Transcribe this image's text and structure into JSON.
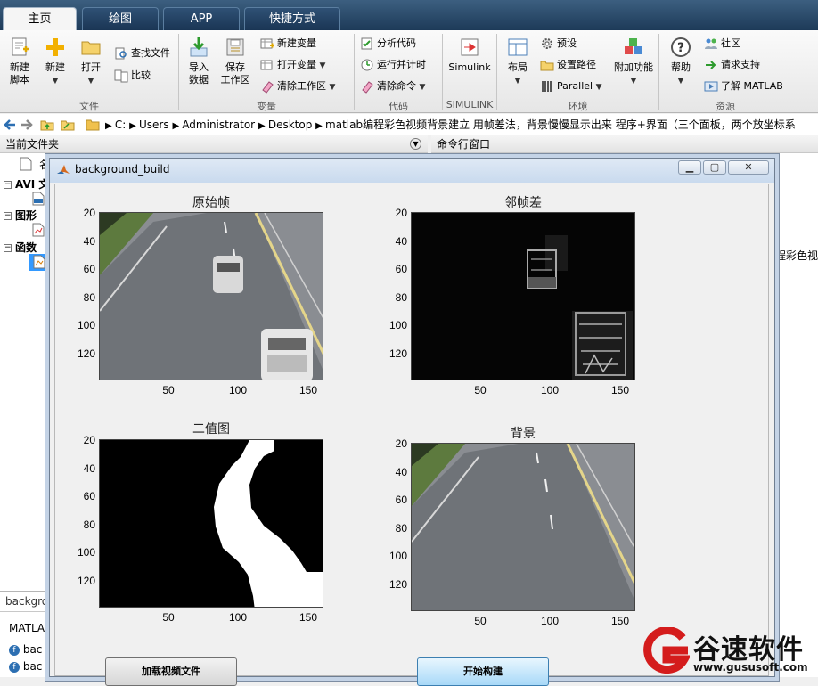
{
  "tabs": [
    {
      "label": "主页",
      "active": true
    },
    {
      "label": "绘图"
    },
    {
      "label": "APP"
    },
    {
      "label": "快捷方式"
    }
  ],
  "ribbon": {
    "file": {
      "label": "文件",
      "new_script": [
        "新建",
        "脚本"
      ],
      "new": "新建",
      "open": "打开",
      "find_files": "查找文件",
      "compare": "比较"
    },
    "variable": {
      "label": "变量",
      "import_data": [
        "导入",
        "数据"
      ],
      "save_workspace": [
        "保存",
        "工作区"
      ],
      "new_variable": "新建变量",
      "open_variable": "打开变量",
      "clear_workspace": "清除工作区"
    },
    "code": {
      "label": "代码",
      "analyze_code": "分析代码",
      "run_and_time": "运行并计时",
      "clear_commands": "清除命令"
    },
    "simulink": {
      "label": "SIMULINK",
      "simulink": "Simulink"
    },
    "environment": {
      "label": "环境",
      "layout": "布局",
      "preferences": "预设",
      "set_path": "设置路径",
      "parallel": "Parallel",
      "addons": "附加功能"
    },
    "resources": {
      "label": "资源",
      "help": "帮助",
      "community": "社区",
      "request_support": "请求支持",
      "learn_matlab": "了解 MATLAB"
    }
  },
  "address": {
    "segments": [
      "C:",
      "Users",
      "Administrator",
      "Desktop",
      "matlab编程彩色视频背景建立 用帧差法，背景慢慢显示出来   程序+界面（三个面板，两个放坐标系"
    ]
  },
  "folder_panel": {
    "header": "当前文件夹",
    "column_name": "名",
    "groups": [
      "AVI 文",
      "图形",
      "函数"
    ],
    "detail_title": "backgro",
    "detail_matlab": "MATLA",
    "detail_items": [
      "bac",
      "bac"
    ]
  },
  "cmd_panel": {
    "header": "命令行窗口",
    "snippet": "程彩色视"
  },
  "figure": {
    "title": "background_build",
    "axes": [
      {
        "title": "原始帧",
        "yticks": [
          "20",
          "40",
          "60",
          "80",
          "100",
          "120"
        ],
        "xticks": [
          "50",
          "100",
          "150"
        ]
      },
      {
        "title": "邻帧差",
        "yticks": [
          "20",
          "40",
          "60",
          "80",
          "100",
          "120"
        ],
        "xticks": [
          "50",
          "100",
          "150"
        ]
      },
      {
        "title": "二值图",
        "yticks": [
          "20",
          "40",
          "60",
          "80",
          "100",
          "120"
        ],
        "xticks": [
          "50",
          "100",
          "150"
        ]
      },
      {
        "title": "背景",
        "yticks": [
          "20",
          "40",
          "60",
          "80",
          "100",
          "120"
        ],
        "xticks": [
          "50",
          "100",
          "150"
        ]
      }
    ],
    "load_button": "加载视频文件",
    "start_button": "开始构建"
  },
  "watermark": {
    "text": "谷速软件",
    "url": "www.gususoft.com"
  },
  "colors": {
    "tabbar": "#1d3a58",
    "start_button": "#a8d9f8",
    "figure_border": "#c4d3e6"
  }
}
